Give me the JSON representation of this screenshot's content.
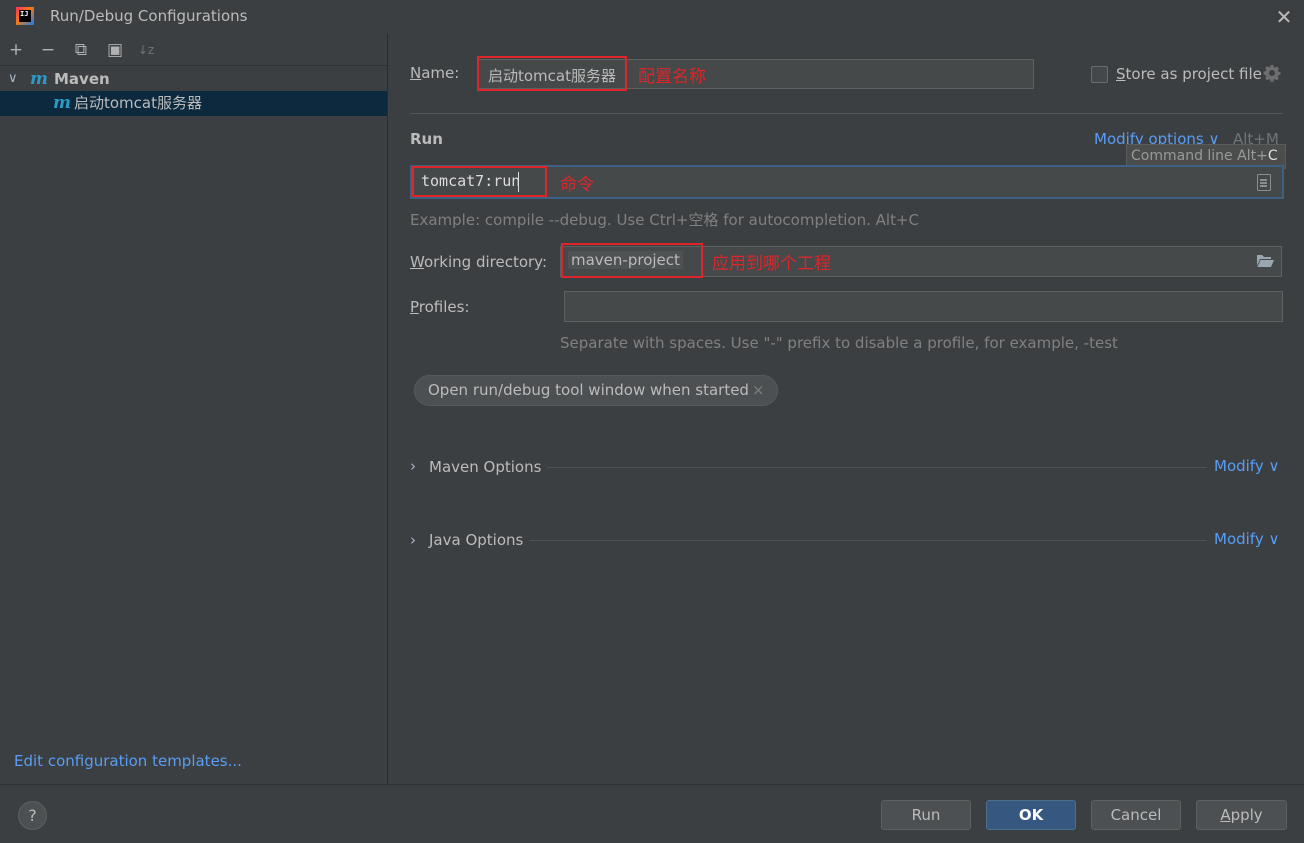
{
  "window": {
    "title": "Run/Debug Configurations",
    "close_glyph": "✕",
    "logo_text": "IJ"
  },
  "toolbar": {
    "add": "+",
    "remove": "−",
    "copy": "⧉",
    "new_folder": "▣",
    "sort": "↓z"
  },
  "tree": {
    "group_chevron": "∨",
    "group_icon": "m",
    "group_label": "Maven",
    "config_icon": "m",
    "config_label": "启动tomcat服务器"
  },
  "left_footer": {
    "edit_templates": "Edit configuration templates..."
  },
  "name": {
    "label_u": "N",
    "label_rest": "ame:",
    "value": "启动tomcat服务器",
    "annotation": "配置名称"
  },
  "store": {
    "label_u": "S",
    "label_rest": "tore as project file",
    "checked": false
  },
  "run_section": {
    "heading": "Run",
    "modify_options": "Modify options ∨",
    "modify_shortcut": "Alt+M",
    "tooltip_text": "Command line Alt+",
    "tooltip_key": "C",
    "command_value": "tomcat7:run",
    "command_annotation": "命令",
    "command_hint": "Example: compile --debug. Use Ctrl+空格 for autocompletion. Alt+C"
  },
  "working_directory": {
    "label_u": "W",
    "label_rest": "orking directory:",
    "value": "maven-project",
    "annotation": "应用到哪个工程"
  },
  "profiles": {
    "label_u": "P",
    "label_rest": "rofiles:",
    "value": "",
    "hint": "Separate with spaces. Use \"-\" prefix to disable a profile, for example, -test"
  },
  "chip": {
    "label": "Open run/debug tool window when started",
    "close": "×"
  },
  "sections": {
    "chevron": "›",
    "maven_options": "Maven Options",
    "java_options": "Java Options",
    "modify": "Modify ∨"
  },
  "buttons": {
    "help": "?",
    "run": "Run",
    "ok": "OK",
    "cancel": "Cancel",
    "apply_u": "A",
    "apply_rest": "pply"
  },
  "colors": {
    "background": "#3c3f41",
    "accent_link": "#589df6",
    "annotation_red": "#e0252a",
    "selection": "#0d293e",
    "ok_button": "#365880"
  }
}
